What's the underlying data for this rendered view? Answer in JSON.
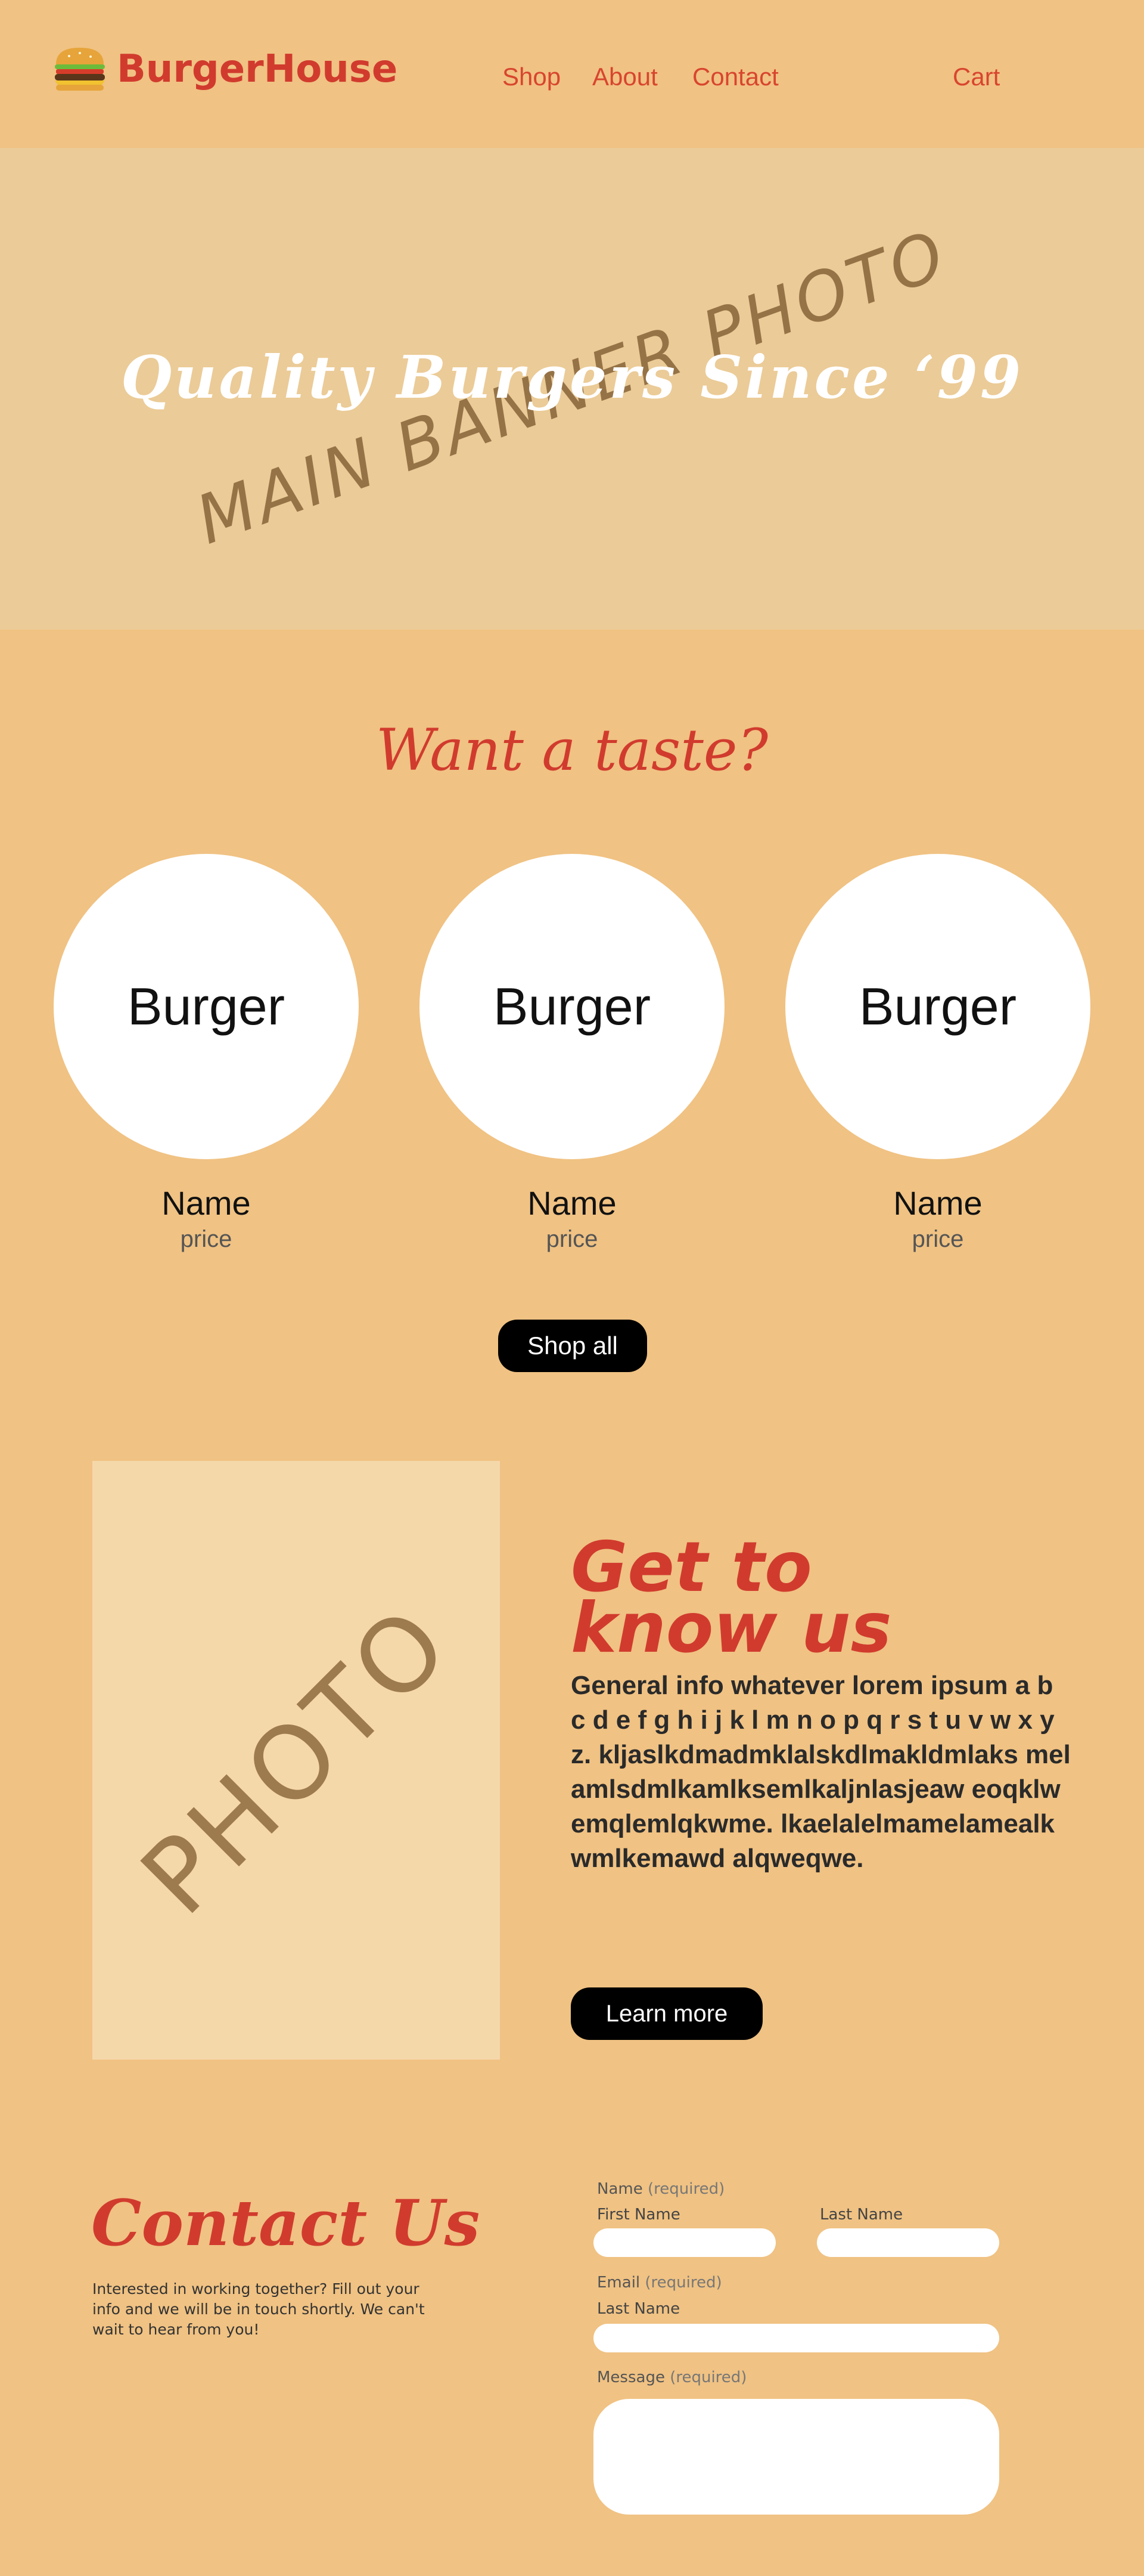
{
  "header": {
    "brand": "BurgerHouse",
    "logo_icon": "burger-icon",
    "nav": [
      "Shop",
      "About",
      "Contact"
    ],
    "cart_label": "Cart"
  },
  "hero": {
    "title": "Quality Burgers Since ‘99",
    "placeholder_label": "MAIN BANNER PHOTO"
  },
  "taste": {
    "heading": "Want a taste?",
    "products": [
      {
        "image_label": "Burger",
        "name": "Name",
        "price": "price"
      },
      {
        "image_label": "Burger",
        "name": "Name",
        "price": "price"
      },
      {
        "image_label": "Burger",
        "name": "Name",
        "price": "price"
      }
    ],
    "shop_all_label": "Shop all"
  },
  "about": {
    "photo_label": "PHOTO",
    "heading": "Get to know us",
    "body": "General info whatever lorem ipsum a b c d e f g h i j k l m n o p q r s t u v w x y z. kljaslkdmadmklalskdlmakldmlaks melamlsdmlkamlksemlkaljnlasjeaw eoqklwemqlemlqkwme. lkaelalelmamelamealkwmlkemawd alqweqwe.",
    "learn_more_label": "Learn more"
  },
  "contact": {
    "heading": "Contact Us",
    "description": "Interested in working together? Fill out your info and we will be in touch shortly. We can't wait to hear from you!",
    "form": {
      "name_label": "Name",
      "required_text": "(required)",
      "first_name_label": "First Name",
      "last_name_label": "Last Name",
      "email_label": "Email",
      "email_sub_label": "Last Name",
      "message_label": "Message"
    }
  },
  "colors": {
    "background": "#f0c283",
    "hero_background": "#ebcb97",
    "accent_red": "#d13b2e",
    "button": "#000000"
  }
}
